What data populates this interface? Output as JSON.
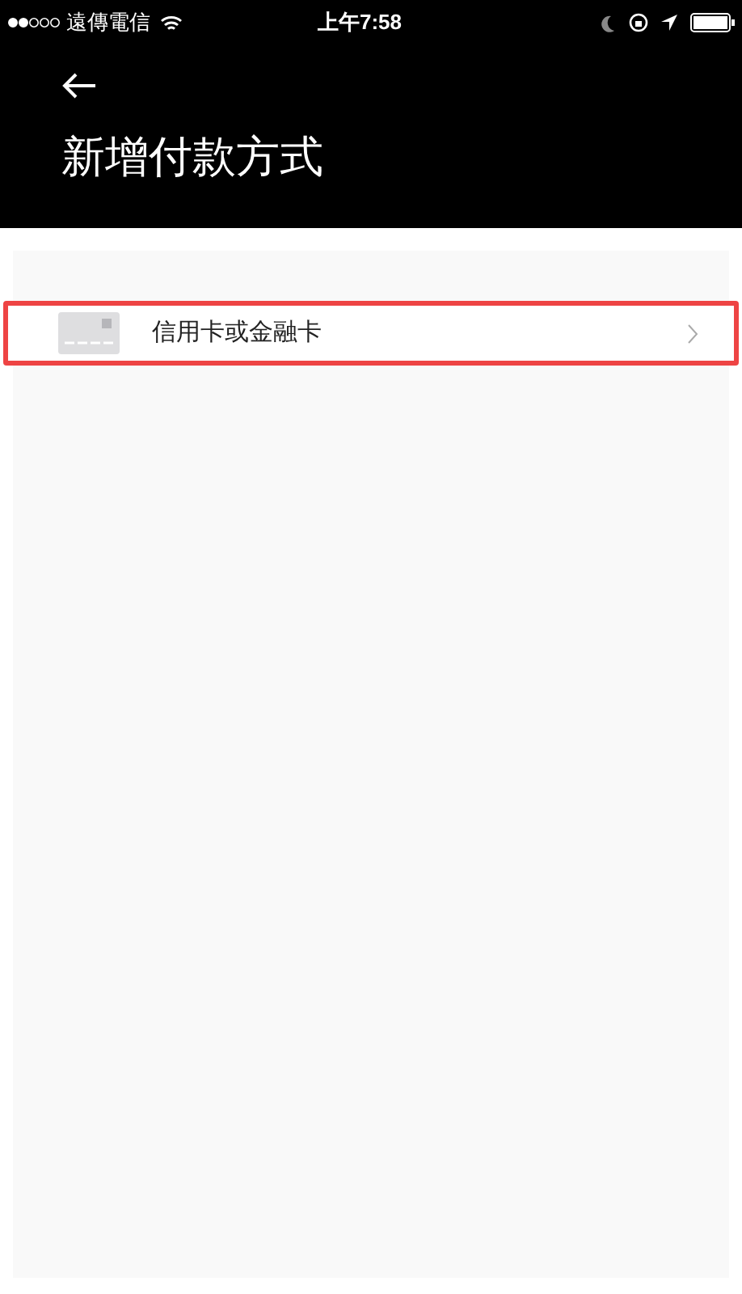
{
  "status_bar": {
    "carrier": "遠傳電信",
    "time": "上午7:58"
  },
  "header": {
    "title": "新增付款方式"
  },
  "options": [
    {
      "label": "信用卡或金融卡",
      "highlighted": true
    }
  ]
}
